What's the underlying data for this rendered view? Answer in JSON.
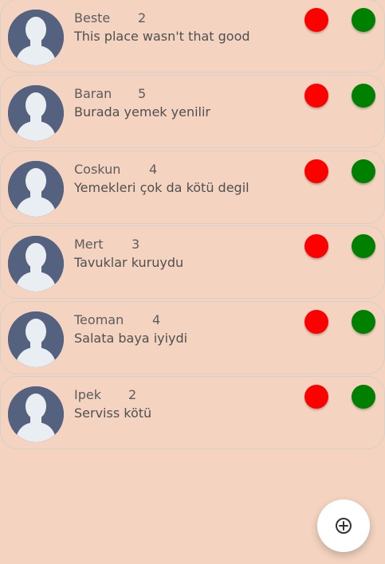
{
  "reviews": [
    {
      "name": "Beste",
      "rating": "2",
      "comment": "This place wasn't that good"
    },
    {
      "name": "Baran",
      "rating": "5",
      "comment": "Burada yemek yenilir"
    },
    {
      "name": "Coskun",
      "rating": "4",
      "comment": "Yemekleri çok da kötü degil"
    },
    {
      "name": "Mert",
      "rating": "3",
      "comment": "Tavuklar kuruydu"
    },
    {
      "name": "Teoman",
      "rating": "4",
      "comment": "Salata baya iyiydi"
    },
    {
      "name": "Ipek",
      "rating": "2",
      "comment": "Serviss kötü"
    }
  ],
  "icons": {
    "avatar": "person-avatar-icon",
    "downvote": "red-circle-button",
    "upvote": "green-circle-button",
    "fab": "add-circle-icon"
  },
  "colors": {
    "background": "#f4d4c0",
    "downvote": "#ff0000",
    "upvote": "#008000",
    "avatar_background": "#546280",
    "avatar_figure": "#e9eef2"
  }
}
